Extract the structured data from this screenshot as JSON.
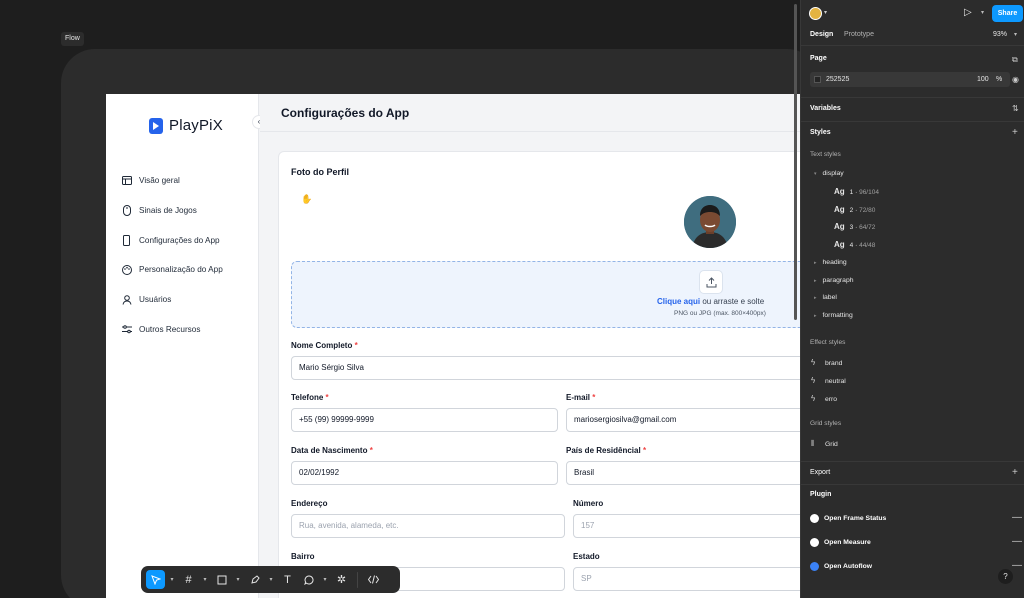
{
  "canvas": {
    "flow_label": "Flow"
  },
  "app": {
    "brand": "PlayPiX",
    "page_title": "Configurações do App",
    "nav": [
      {
        "label": "Visão geral",
        "icon": "layout-icon"
      },
      {
        "label": "Sinais de Jogos",
        "icon": "mouse-icon"
      },
      {
        "label": "Configurações do App",
        "icon": "phone-icon"
      },
      {
        "label": "Personalização do App",
        "icon": "palette-icon"
      },
      {
        "label": "Usuários",
        "icon": "user-icon"
      },
      {
        "label": "Outros Recursos",
        "icon": "sliders-icon"
      }
    ],
    "section_title": "Foto do Perfil",
    "upload": {
      "link": "Clique aqui",
      "text": " ou arraste e solte",
      "hint": "PNG ou JPG (max. 800×400px)"
    },
    "fields": {
      "nome": {
        "label": "Nome Completo",
        "value": "Mario Sérgio Silva"
      },
      "telefone": {
        "label": "Telefone",
        "value": "+55 (99) 99999-9999"
      },
      "email": {
        "label": "E-mail",
        "value": "mariosergiosilva@gmail.com"
      },
      "nascimento": {
        "label": "Data de Nascimento",
        "value": "02/02/1992"
      },
      "pais": {
        "label": "País de Residêncial",
        "value": "Brasil"
      },
      "endereco": {
        "label": "Endereço",
        "placeholder": "Rua, avenida, alameda, etc."
      },
      "numero": {
        "label": "Número",
        "placeholder": "157"
      },
      "bairro": {
        "label": "Bairro"
      },
      "estado": {
        "label": "Estado",
        "placeholder": "SP"
      }
    },
    "required_mark": "*"
  },
  "panel": {
    "share": "Share",
    "tab_design": "Design",
    "tab_prototype": "Prototype",
    "zoom": "93%",
    "page_header": "Page",
    "page_color": "252525",
    "page_opacity": "100",
    "page_pct": "%",
    "variables": "Variables",
    "styles": "Styles",
    "text_styles": "Text styles",
    "display": "display",
    "display_items": [
      {
        "ag": "Ag",
        "n": "1",
        "meta": "96/104"
      },
      {
        "ag": "Ag",
        "n": "2",
        "meta": "72/80"
      },
      {
        "ag": "Ag",
        "n": "3",
        "meta": "64/72"
      },
      {
        "ag": "Ag",
        "n": "4",
        "meta": "44/48"
      }
    ],
    "text_groups": [
      "heading",
      "paragraph",
      "label",
      "formatting"
    ],
    "effect_styles": "Effect styles",
    "effects": [
      "brand",
      "neutral",
      "erro"
    ],
    "grid_styles": "Grid styles",
    "grid": "Grid",
    "export": "Export",
    "plugin": "Plugin",
    "plugins": [
      "Open Frame Status",
      "Open Measure",
      "Open Autoflow"
    ],
    "help": "?"
  },
  "colors": {
    "accent": "#0d99ff",
    "brand": "#2563eb",
    "panel_bg": "#2c2c2c"
  }
}
